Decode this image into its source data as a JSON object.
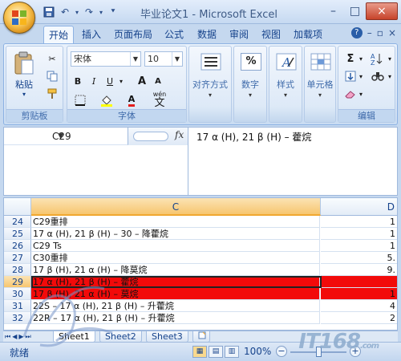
{
  "window": {
    "title": "毕业论文1 - Microsoft Excel",
    "controls": {
      "min": "–",
      "max": "□",
      "close": "×"
    },
    "ribbon_controls": {
      "min": "–",
      "restore": "▫",
      "close": "×"
    }
  },
  "tabs": [
    "开始",
    "插入",
    "页面布局",
    "公式",
    "数据",
    "审阅",
    "视图",
    "加载项"
  ],
  "active_tab": "开始",
  "ribbon": {
    "clipboard": {
      "label": "剪贴板",
      "paste": "粘贴"
    },
    "font": {
      "label": "字体",
      "font_name": "宋体",
      "font_size": "10",
      "bold": "B",
      "italic": "I",
      "underline": "U",
      "grow": "A",
      "shrink": "A",
      "phonetic": "wén",
      "phonetic_char": "文"
    },
    "alignment": {
      "label": "对齐方式"
    },
    "number": {
      "label": "数字",
      "icon": "%"
    },
    "styles": {
      "label": "样式"
    },
    "cells": {
      "label": "单元格"
    },
    "editing": {
      "label": "编辑"
    }
  },
  "formula_bar": {
    "name_box": "C29",
    "fx": "fx",
    "formula": "17 α (H), 21 β (H) – 藿烷"
  },
  "grid": {
    "columns": [
      "C",
      "D"
    ],
    "selected_column": "C",
    "rows": [
      {
        "num": "24",
        "c": "C29重排",
        "d": "1",
        "selected": false,
        "red": false
      },
      {
        "num": "25",
        "c": "17 α (H), 21 β (H) – 30 – 降藿烷",
        "d": "1",
        "selected": false,
        "red": false
      },
      {
        "num": "26",
        "c": "C29 Ts",
        "d": "1",
        "selected": false,
        "red": false
      },
      {
        "num": "27",
        "c": "C30重排",
        "d": "5.",
        "selected": false,
        "red": false
      },
      {
        "num": "28",
        "c": "17 β (H), 21 α (H) – 降莫烷",
        "d": "9.",
        "selected": false,
        "red": false
      },
      {
        "num": "29",
        "c": "17 α (H), 21 β (H) – 藿烷",
        "d": "",
        "selected": true,
        "red": true
      },
      {
        "num": "30",
        "c": "17 β (H), 21 α (H) – 莫烷",
        "d": "1",
        "selected": false,
        "red": true
      },
      {
        "num": "31",
        "c": "22S – 17 α (H), 21 β (H) – 升藿烷",
        "d": "4",
        "selected": false,
        "red": false
      },
      {
        "num": "32",
        "c": "22R – 17 α (H), 21 β (H) – 升藿烷",
        "d": "2",
        "selected": false,
        "red": false
      }
    ]
  },
  "sheets": [
    "Sheet1",
    "Sheet2",
    "Sheet3"
  ],
  "active_sheet": "Sheet1",
  "status": {
    "ready": "就绪",
    "zoom": "100%",
    "zoom_minus": "−",
    "zoom_plus": "+"
  },
  "watermark": {
    "brand": "IT168",
    "brand_suffix": ".com"
  }
}
